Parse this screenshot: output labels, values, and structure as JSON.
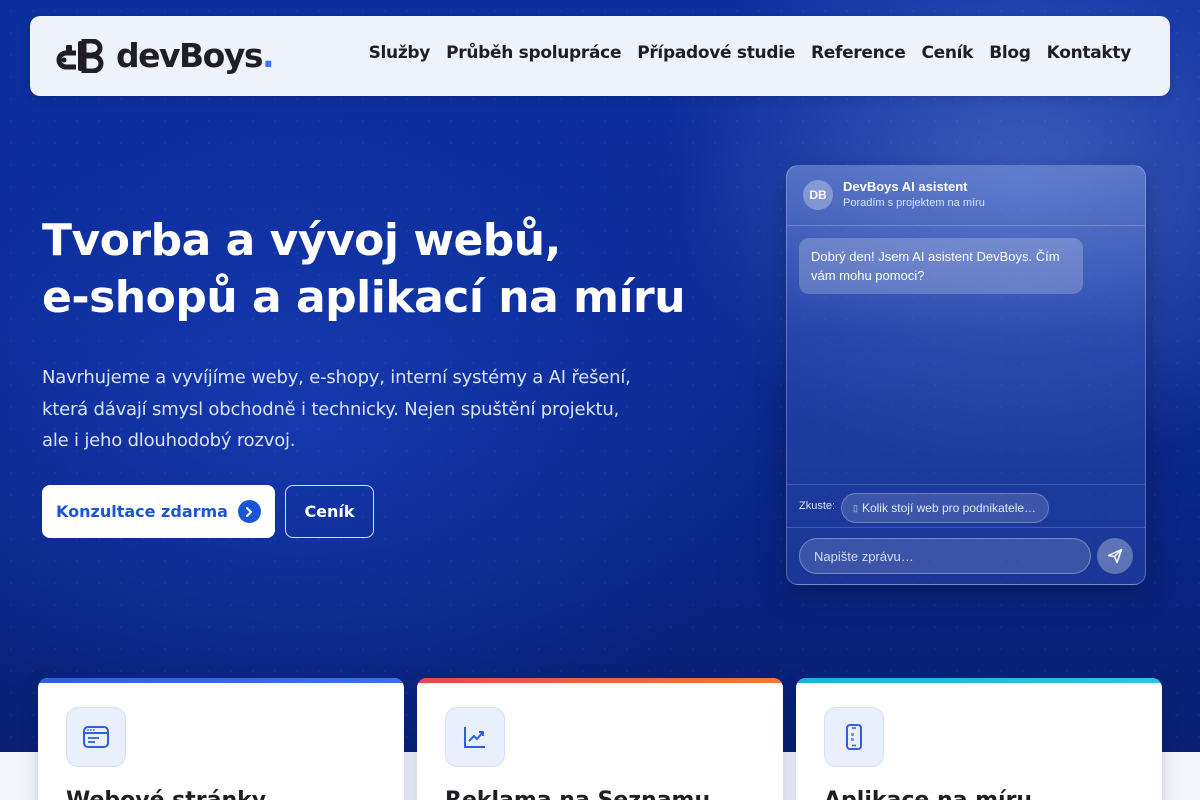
{
  "brand": {
    "name": "devBoys",
    "dot": ".",
    "accent_color": "#3a7bf2"
  },
  "nav": {
    "items": [
      {
        "label": "Služby"
      },
      {
        "label": "Průběh spolupráce"
      },
      {
        "label": "Případové studie"
      },
      {
        "label": "Reference"
      },
      {
        "label": "Ceník"
      },
      {
        "label": "Blog"
      },
      {
        "label": "Kontakty"
      }
    ]
  },
  "hero": {
    "title_line1": "Tvorba a vývoj webů,",
    "title_line2": "e-shopů a aplikací na míru",
    "desc_line1": "Navrhujeme a vyvíjíme weby, e-shopy, interní systémy a AI řešení,",
    "desc_line2": "která dávají smysl obchodně i technicky. Nejen spuštění projektu,",
    "desc_line3": "ale i jeho dlouhodobý rozvoj.",
    "primary_button": "Konzultace zdarma",
    "secondary_button": "Ceník"
  },
  "chat": {
    "avatar": "DB",
    "name": "DevBoys AI asistent",
    "subtitle": "Poradím s projektem na míru",
    "greeting": "Dobrý den! Jsem AI asistent DevBoys. Čím vám mohu pomoci?",
    "suggest_label": "Zkuste:",
    "suggestion": "Kolik stojí web pro podnikatele…",
    "input_placeholder": "Napište zprávu…"
  },
  "cards": [
    {
      "title": "Webové stránky",
      "icon": "browser-window-icon",
      "accent": "#2f5fe0"
    },
    {
      "title": "Reklama na Seznamu",
      "icon": "trend-chart-icon",
      "accent": "#e8474a"
    },
    {
      "title": "Aplikace na míru",
      "icon": "smartphone-icon",
      "accent": "#19b3d6"
    }
  ]
}
